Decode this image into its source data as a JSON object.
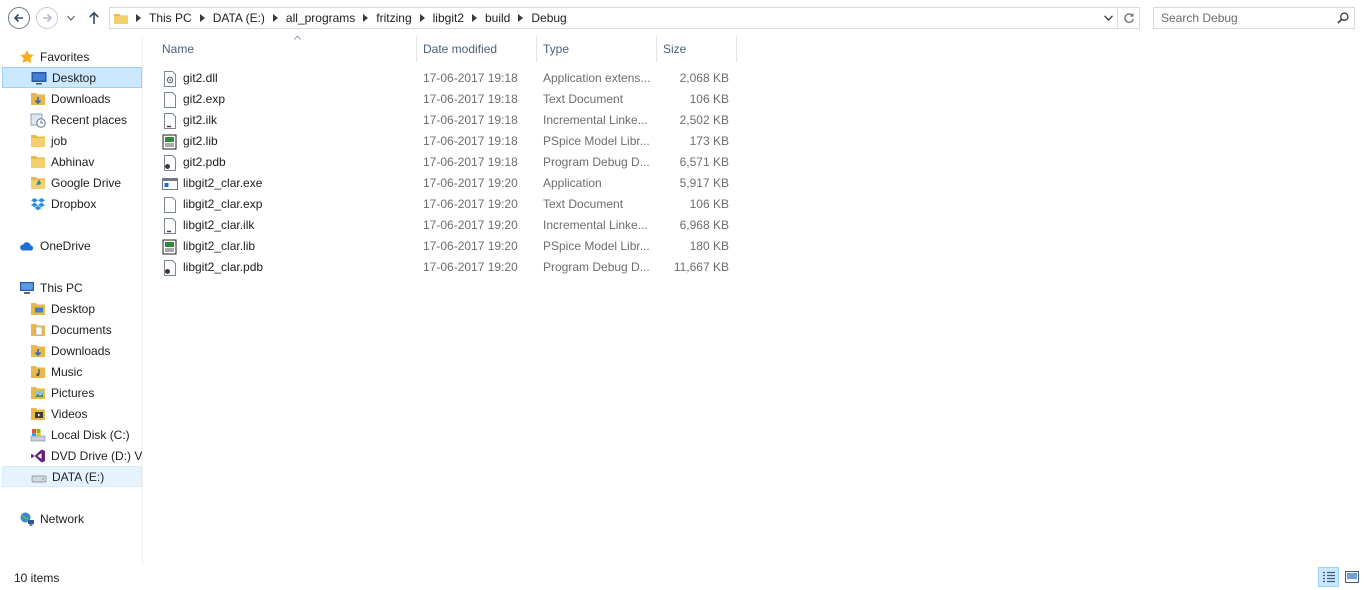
{
  "addressbar": {
    "breadcrumbs": [
      "This PC",
      "DATA (E:)",
      "all_programs",
      "fritzing",
      "libgit2",
      "build",
      "Debug"
    ]
  },
  "search": {
    "placeholder": "Search Debug"
  },
  "navpane": {
    "favorites": {
      "label": "Favorites",
      "items": [
        {
          "label": "Desktop",
          "icon": "desktop-icon",
          "selected": true
        },
        {
          "label": "Downloads",
          "icon": "downloads-folder-icon"
        },
        {
          "label": "Recent places",
          "icon": "recent-places-icon"
        },
        {
          "label": "job",
          "icon": "folder-icon"
        },
        {
          "label": "Abhinav",
          "icon": "folder-icon"
        },
        {
          "label": "Google Drive",
          "icon": "google-drive-folder-icon"
        },
        {
          "label": "Dropbox",
          "icon": "dropbox-icon"
        }
      ]
    },
    "onedrive": {
      "label": "OneDrive"
    },
    "thispc": {
      "label": "This PC",
      "items": [
        {
          "label": "Desktop",
          "icon": "desktop-folder-icon"
        },
        {
          "label": "Documents",
          "icon": "documents-folder-icon"
        },
        {
          "label": "Downloads",
          "icon": "downloads-folder-icon"
        },
        {
          "label": "Music",
          "icon": "music-folder-icon"
        },
        {
          "label": "Pictures",
          "icon": "pictures-folder-icon"
        },
        {
          "label": "Videos",
          "icon": "videos-folder-icon"
        },
        {
          "label": "Local Disk (C:)",
          "icon": "local-disk-icon"
        },
        {
          "label": "DVD Drive (D:) VS",
          "icon": "visual-studio-dvd-icon"
        },
        {
          "label": "DATA (E:)",
          "icon": "drive-icon",
          "selected": true
        }
      ]
    },
    "network": {
      "label": "Network"
    }
  },
  "columns": {
    "name": "Name",
    "date": "Date modified",
    "type": "Type",
    "size": "Size"
  },
  "files": [
    {
      "name": "git2.dll",
      "date": "17-06-2017 19:18",
      "type": "Application extens...",
      "size": "2,068 KB",
      "icon": "dll-file-icon"
    },
    {
      "name": "git2.exp",
      "date": "17-06-2017 19:18",
      "type": "Text Document",
      "size": "106 KB",
      "icon": "text-file-icon"
    },
    {
      "name": "git2.ilk",
      "date": "17-06-2017 19:18",
      "type": "Incremental Linke...",
      "size": "2,502 KB",
      "icon": "ilk-file-icon"
    },
    {
      "name": "git2.lib",
      "date": "17-06-2017 19:18",
      "type": "PSpice Model Libr...",
      "size": "173 KB",
      "icon": "lib-file-icon"
    },
    {
      "name": "git2.pdb",
      "date": "17-06-2017 19:18",
      "type": "Program Debug D...",
      "size": "6,571 KB",
      "icon": "pdb-file-icon"
    },
    {
      "name": "libgit2_clar.exe",
      "date": "17-06-2017 19:20",
      "type": "Application",
      "size": "5,917 KB",
      "icon": "exe-file-icon"
    },
    {
      "name": "libgit2_clar.exp",
      "date": "17-06-2017 19:20",
      "type": "Text Document",
      "size": "106 KB",
      "icon": "text-file-icon"
    },
    {
      "name": "libgit2_clar.ilk",
      "date": "17-06-2017 19:20",
      "type": "Incremental Linke...",
      "size": "6,968 KB",
      "icon": "ilk-file-icon"
    },
    {
      "name": "libgit2_clar.lib",
      "date": "17-06-2017 19:20",
      "type": "PSpice Model Libr...",
      "size": "180 KB",
      "icon": "lib-file-icon"
    },
    {
      "name": "libgit2_clar.pdb",
      "date": "17-06-2017 19:20",
      "type": "Program Debug D...",
      "size": "11,667 KB",
      "icon": "pdb-file-icon"
    }
  ],
  "status": {
    "item_count": "10 items"
  },
  "colors": {
    "selection": "#cce8ff",
    "selection_border": "#99d1ff",
    "header_text": "#4c607a",
    "folder": "#e8b84a"
  }
}
